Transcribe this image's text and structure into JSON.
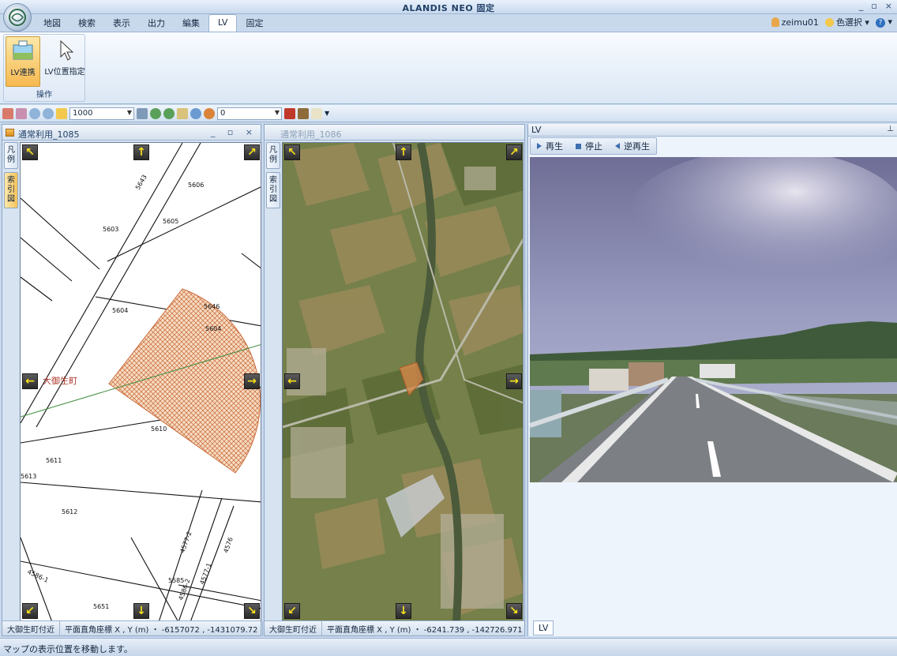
{
  "window": {
    "title": "ALANDIS NEO 固定",
    "controls": [
      "_",
      "▫",
      "×"
    ]
  },
  "ribbon": {
    "tabs": [
      "地図",
      "検索",
      "表示",
      "出力",
      "編集",
      "LV",
      "固定"
    ],
    "active_tab": "LV",
    "user": "zeimu01",
    "color_select": "色選択",
    "group": {
      "label": "操作",
      "buttons": [
        "LV連携",
        "LV位置指定"
      ]
    }
  },
  "toolbar": {
    "scale_value": "1000",
    "rotation_value": "0"
  },
  "panes": [
    {
      "title": "通常利用_1085",
      "side_tabs": [
        "凡例",
        "索引図"
      ],
      "status_location": "大御生町付近",
      "status_coords": "平面直角座標 X , Y (m) ・ -6157072 , -1431079.72",
      "parcels": [
        "5606",
        "5605",
        "5604",
        "5603",
        "5604",
        "5646",
        "5610",
        "5611",
        "5612",
        "5613",
        "5651",
        "5585",
        "4577-2",
        "4576",
        "4586-1",
        "4586-2",
        "4577-1"
      ],
      "town_label": "大御生町"
    },
    {
      "title": "通常利用_1086",
      "side_tabs": [
        "凡例",
        "索引図"
      ],
      "status_location": "大御生町付近",
      "status_coords": "平面直角座標 X , Y (m) ・ -6241.739 , -142726.971"
    }
  ],
  "lv": {
    "title": "LV",
    "play": "再生",
    "stop": "停止",
    "reverse": "逆再生",
    "bottom_tab": "LV"
  },
  "statusbar": {
    "message": "マップの表示位置を移動します。"
  },
  "colors": {
    "accent": "#f6b950",
    "pan_arrow": "#f8e21a",
    "parcel_fill": "#f2c9a4"
  }
}
